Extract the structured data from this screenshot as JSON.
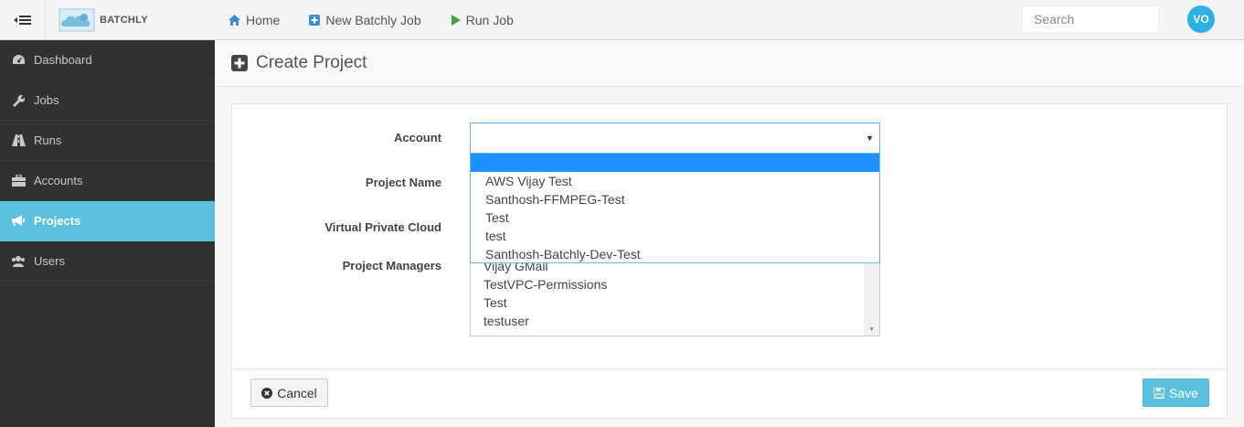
{
  "brand": {
    "name": "BATCHLY"
  },
  "nav": [
    {
      "label": "Home",
      "icon": "home-icon"
    },
    {
      "label": "New Batchly Job",
      "icon": "plus-square-icon"
    },
    {
      "label": "Run Job",
      "icon": "play-icon"
    }
  ],
  "search": {
    "placeholder": "Search",
    "value": ""
  },
  "user": {
    "initials": "VO"
  },
  "sidebar": {
    "items": [
      {
        "label": "Dashboard",
        "icon": "dashboard-icon",
        "active": false
      },
      {
        "label": "Jobs",
        "icon": "wrench-icon",
        "active": false
      },
      {
        "label": "Runs",
        "icon": "road-icon",
        "active": false
      },
      {
        "label": "Accounts",
        "icon": "briefcase-icon",
        "active": false
      },
      {
        "label": "Projects",
        "icon": "bullhorn-icon",
        "active": true
      },
      {
        "label": "Users",
        "icon": "users-icon",
        "active": false
      }
    ]
  },
  "page": {
    "title": "Create Project"
  },
  "form": {
    "account_label": "Account",
    "account_value": "",
    "project_name_label": "Project Name",
    "vpc_label": "Virtual Private Cloud",
    "project_managers_label": "Project Managers",
    "project_managers_options": [
      "Vijay GMail",
      "TestVPC-Permissions",
      "Test",
      "testuser"
    ]
  },
  "account_dropdown": {
    "options": [
      "",
      "AWS Vijay Test",
      "Santhosh-FFMPEG-Test",
      "Test",
      "test",
      "Santhosh-Batchly-Dev-Test"
    ]
  },
  "buttons": {
    "cancel": "Cancel",
    "save": "Save"
  },
  "colors": {
    "accent": "#5bc0de",
    "sidebar_bg": "#2f3133",
    "avatar": "#2cb0e8",
    "highlight": "#1e90ff"
  }
}
